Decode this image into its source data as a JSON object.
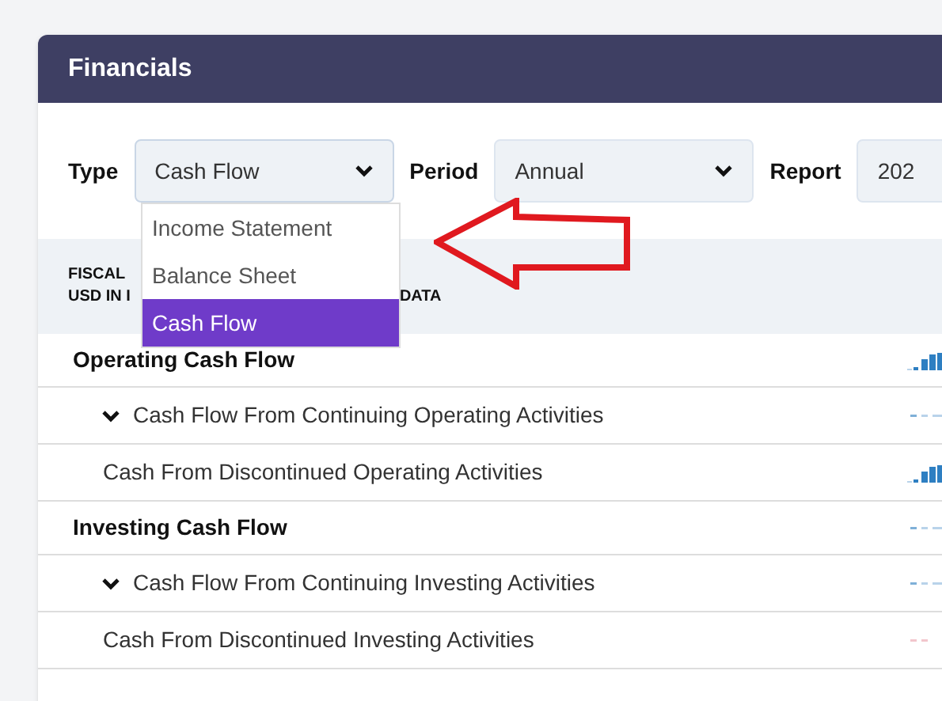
{
  "card": {
    "title": "Financials"
  },
  "filters": [
    {
      "label": "Type",
      "value": "Cash Flow",
      "open": true
    },
    {
      "label": "Period",
      "value": "Annual",
      "open": false
    },
    {
      "label": "Report",
      "value": "202",
      "open": false
    }
  ],
  "type_menu": [
    {
      "label": "Income Statement",
      "selected": false
    },
    {
      "label": "Balance Sheet",
      "selected": false
    },
    {
      "label": "Cash Flow",
      "selected": true
    }
  ],
  "table_header": {
    "line_1": "FISCAL",
    "line_2": "USD IN I",
    "line_2_end": "DATA"
  },
  "rows": [
    {
      "kind": "section",
      "label": "Operating Cash Flow",
      "sparkline": {
        "kind": "bars"
      }
    },
    {
      "kind": "group",
      "label": "Cash Flow From Continuing Operating Activities",
      "expanded": true,
      "sparkline": {
        "kind": "dashes"
      }
    },
    {
      "kind": "item",
      "label": "Cash From Discontinued Operating Activities",
      "sparkline": {
        "kind": "bars"
      }
    },
    {
      "kind": "section",
      "label": "Investing Cash Flow",
      "sparkline": {
        "kind": "dashes"
      }
    },
    {
      "kind": "group",
      "label": "Cash Flow From Continuing Investing Activities",
      "expanded": true,
      "sparkline": {
        "kind": "dashes"
      }
    },
    {
      "kind": "item",
      "label": "Cash From Discontinued Investing Activities",
      "sparkline": {
        "kind": "faint"
      }
    }
  ]
}
